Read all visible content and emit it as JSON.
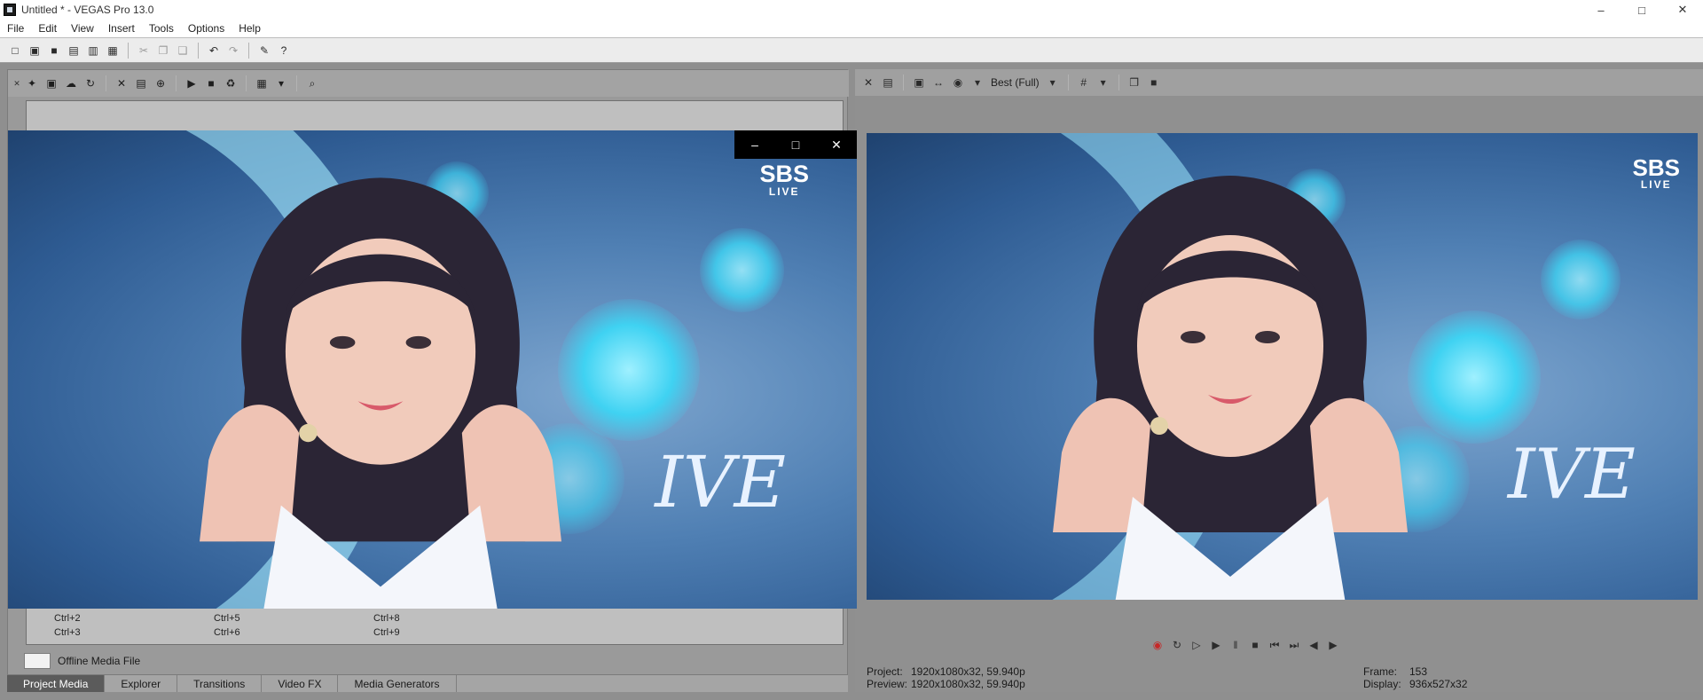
{
  "window": {
    "title": "Untitled * - VEGAS Pro 13.0",
    "controls": {
      "minimize": "–",
      "maximize": "□",
      "close": "✕"
    }
  },
  "menu": [
    "File",
    "Edit",
    "View",
    "Insert",
    "Tools",
    "Options",
    "Help"
  ],
  "toolbar_icons": [
    {
      "name": "new-icon",
      "glyph": "□"
    },
    {
      "name": "open-icon",
      "glyph": "▣"
    },
    {
      "name": "save-icon",
      "glyph": "■"
    },
    {
      "name": "save-as-icon",
      "glyph": "▤"
    },
    {
      "name": "render-icon",
      "glyph": "▥"
    },
    {
      "name": "properties-icon",
      "glyph": "▦"
    },
    {
      "name": "cut-icon",
      "glyph": "✂"
    },
    {
      "name": "copy-icon",
      "glyph": "❐"
    },
    {
      "name": "paste-icon",
      "glyph": "❑"
    },
    {
      "name": "undo-icon",
      "glyph": "↶"
    },
    {
      "name": "redo-icon",
      "glyph": "↷"
    },
    {
      "name": "enable-snapping-icon",
      "glyph": "✎"
    },
    {
      "name": "whats-this-icon",
      "glyph": "?"
    }
  ],
  "media_panel": {
    "tool_icons": [
      {
        "name": "import-media-icon",
        "glyph": "✦"
      },
      {
        "name": "capture-video-icon",
        "glyph": "▣"
      },
      {
        "name": "get-media-from-web-icon",
        "glyph": "☁"
      },
      {
        "name": "refresh-icon",
        "glyph": "↻"
      },
      {
        "name": "remove-icon",
        "glyph": "✕"
      },
      {
        "name": "media-properties-icon",
        "glyph": "▤"
      },
      {
        "name": "media-fx-icon",
        "glyph": "⊕"
      },
      {
        "name": "play-icon",
        "glyph": "▶"
      },
      {
        "name": "stop-icon",
        "glyph": "■"
      },
      {
        "name": "auto-preview-icon",
        "glyph": "♻"
      },
      {
        "name": "views-icon",
        "glyph": "▦"
      },
      {
        "name": "search-icon",
        "glyph": "⌕"
      }
    ],
    "shortcuts": [
      [
        "Ctrl+2",
        "Ctrl+5",
        "Ctrl+8"
      ],
      [
        "Ctrl+3",
        "Ctrl+6",
        "Ctrl+9"
      ]
    ],
    "offline_label": "Offline Media File"
  },
  "tabs": [
    {
      "label": "Project Media",
      "active": true
    },
    {
      "label": "Explorer",
      "active": false
    },
    {
      "label": "Transitions",
      "active": false
    },
    {
      "label": "Video FX",
      "active": false
    },
    {
      "label": "Media Generators",
      "active": false
    }
  ],
  "preview": {
    "tool_icons": [
      {
        "name": "preview-properties-icon",
        "glyph": "▤"
      },
      {
        "name": "external-monitor-icon",
        "glyph": "▣"
      },
      {
        "name": "split-screen-icon",
        "glyph": "↔"
      },
      {
        "name": "overlays-icon",
        "glyph": "◉"
      }
    ],
    "quality": "Best (Full)",
    "extra_icons": [
      {
        "name": "grid-icon",
        "glyph": "#"
      },
      {
        "name": "copy-snapshot-icon",
        "glyph": "❐"
      },
      {
        "name": "save-snapshot-icon",
        "glyph": "■"
      }
    ],
    "transport": [
      {
        "name": "record-icon",
        "glyph": "◉"
      },
      {
        "name": "loop-playback-icon",
        "glyph": "↻"
      },
      {
        "name": "play-from-start-icon",
        "glyph": "▷"
      },
      {
        "name": "play-icon",
        "glyph": "▶"
      },
      {
        "name": "pause-icon",
        "glyph": "‖"
      },
      {
        "name": "stop-icon",
        "glyph": "■"
      },
      {
        "name": "go-to-start-icon",
        "glyph": "⏮"
      },
      {
        "name": "go-to-end-icon",
        "glyph": "⏭"
      },
      {
        "name": "previous-frame-icon",
        "glyph": "◀"
      },
      {
        "name": "next-frame-icon",
        "glyph": "▶"
      }
    ],
    "status": {
      "project_label": "Project:",
      "project_value": "1920x1080x32, 59.940p",
      "preview_label": "Preview:",
      "preview_value": "1920x1080x32, 59.940p",
      "frame_label": "Frame:",
      "frame_value": "153",
      "display_label": "Display:",
      "display_value": "936x527x32"
    }
  },
  "video_overlay": {
    "broadcaster": "SBS",
    "broadcaster_sub": "LIVE",
    "group_logo": "IVE"
  },
  "colors": {
    "accent_blue": "#3fd2f2",
    "panel_gray": "#9a9a9a",
    "active_tab": "#5b5b5b"
  }
}
